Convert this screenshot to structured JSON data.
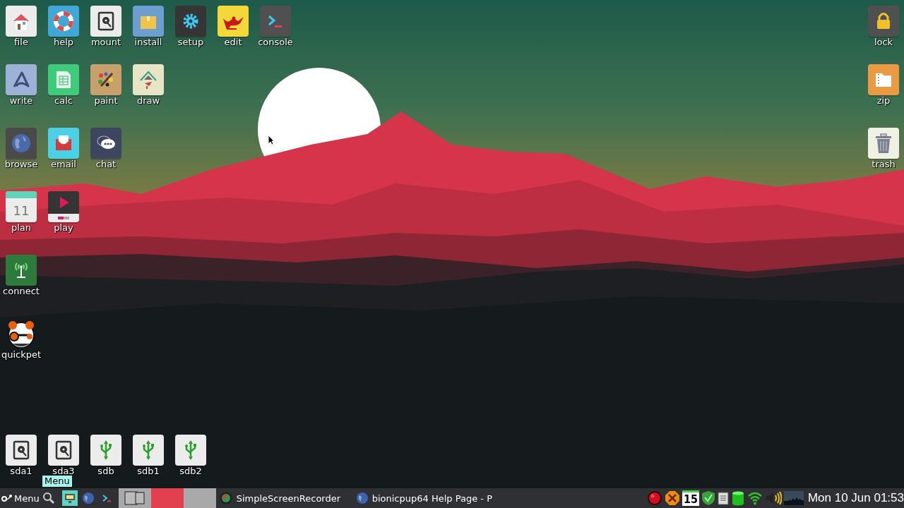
{
  "desktop": {
    "icon_rows": [
      [
        {
          "label": "file",
          "kind": "home"
        },
        {
          "label": "help",
          "kind": "help"
        },
        {
          "label": "mount",
          "kind": "drive"
        },
        {
          "label": "install",
          "kind": "package"
        },
        {
          "label": "setup",
          "kind": "gear"
        },
        {
          "label": "edit",
          "kind": "lamp"
        },
        {
          "label": "console",
          "kind": "terminal"
        }
      ],
      [
        {
          "label": "write",
          "kind": "write"
        },
        {
          "label": "calc",
          "kind": "sheet"
        },
        {
          "label": "paint",
          "kind": "paint"
        },
        {
          "label": "draw",
          "kind": "draw"
        }
      ],
      [
        {
          "label": "browse",
          "kind": "globe"
        },
        {
          "label": "email",
          "kind": "mail"
        },
        {
          "label": "chat",
          "kind": "chat"
        }
      ],
      [
        {
          "label": "plan",
          "kind": "calendar",
          "date": "11"
        },
        {
          "label": "play",
          "kind": "media"
        }
      ],
      [
        {
          "label": "connect",
          "kind": "antenna"
        }
      ],
      [
        {
          "label": "quickpet",
          "kind": "mascot"
        }
      ]
    ],
    "right_icons": [
      {
        "label": "lock",
        "kind": "lock"
      },
      {
        "label": "zip",
        "kind": "zip"
      },
      {
        "label": "trash",
        "kind": "trash"
      }
    ],
    "drive_icons": [
      {
        "label": "sda1",
        "kind": "drive"
      },
      {
        "label": "sda3",
        "kind": "drive"
      },
      {
        "label": "sdb",
        "kind": "usb"
      },
      {
        "label": "sdb1",
        "kind": "usb"
      },
      {
        "label": "sdb2",
        "kind": "usb"
      }
    ]
  },
  "tooltip": "Menu",
  "taskbar": {
    "menu_label": "Menu",
    "launchers": [
      {
        "kind": "display",
        "highlighted": true
      },
      {
        "kind": "globe",
        "highlighted": false
      },
      {
        "kind": "terminal",
        "highlighted": false
      }
    ],
    "pager": [
      {
        "selected": false,
        "has_windows": true
      },
      {
        "selected": true,
        "has_windows": false
      },
      {
        "selected": false,
        "has_windows": false
      }
    ],
    "tasks": [
      {
        "label": "SimpleScreenRecorder",
        "kind": "recorder"
      },
      {
        "label": "bionicpup64 Help Page - P",
        "kind": "globe"
      }
    ],
    "tray": [
      {
        "kind": "record"
      },
      {
        "kind": "xcross"
      },
      {
        "kind": "calendar",
        "date": "15"
      },
      {
        "kind": "shield"
      },
      {
        "kind": "clipboard"
      },
      {
        "kind": "cylinder"
      },
      {
        "kind": "wifi"
      },
      {
        "kind": "speaker"
      },
      {
        "kind": "cpu"
      }
    ],
    "clock": "Mon 10 Jun 01:53"
  }
}
